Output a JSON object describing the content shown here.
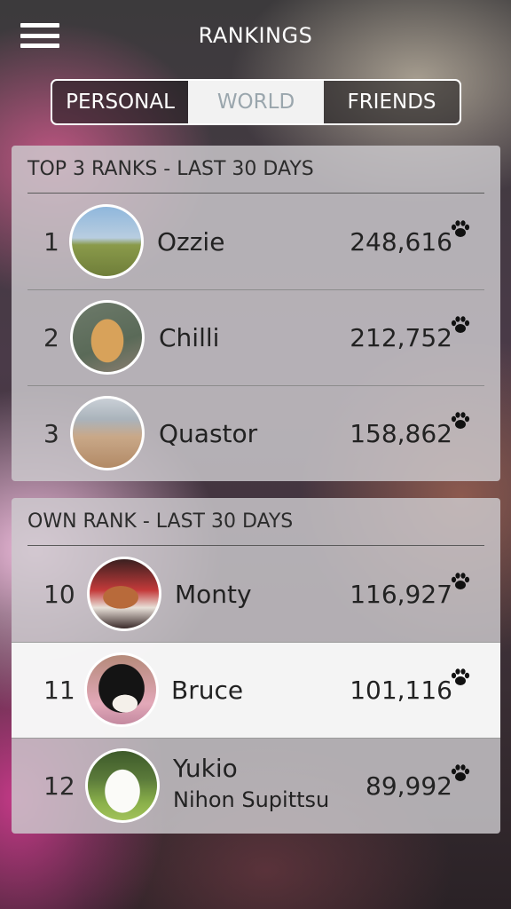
{
  "header": {
    "title": "RANKINGS",
    "menu_icon": "hamburger-menu-icon"
  },
  "tabs": [
    {
      "label": "PERSONAL",
      "active": false
    },
    {
      "label": "WORLD",
      "active": true
    },
    {
      "label": "FRIENDS",
      "active": false
    }
  ],
  "top_ranks": {
    "heading": "TOP 3 RANKS - LAST 30 DAYS",
    "rows": [
      {
        "rank": "1",
        "name": "Ozzie",
        "score": "248,616",
        "avatar": "dog-photo"
      },
      {
        "rank": "2",
        "name": "Chilli",
        "score": "212,752",
        "avatar": "dog-photo"
      },
      {
        "rank": "3",
        "name": "Quastor",
        "score": "158,862",
        "avatar": "dog-photo"
      }
    ]
  },
  "own_rank": {
    "heading": "OWN RANK - LAST 30 DAYS",
    "rows": [
      {
        "rank": "10",
        "name": "Monty",
        "score": "116,927",
        "avatar": "dog-photo"
      },
      {
        "rank": "11",
        "name": "Bruce",
        "score": "101,116",
        "avatar": "cat-photo",
        "highlighted": true
      },
      {
        "rank": "12",
        "name": "Yukio",
        "subname": "Nihon Supittsu",
        "score": "89,992",
        "avatar": "dog-photo"
      }
    ]
  },
  "score_icon": "paw-icon",
  "colors": {
    "active_tab_bg": "#f2f2f2",
    "active_tab_text": "#9aa6ad",
    "highlight_row": "#f8f8f8"
  }
}
